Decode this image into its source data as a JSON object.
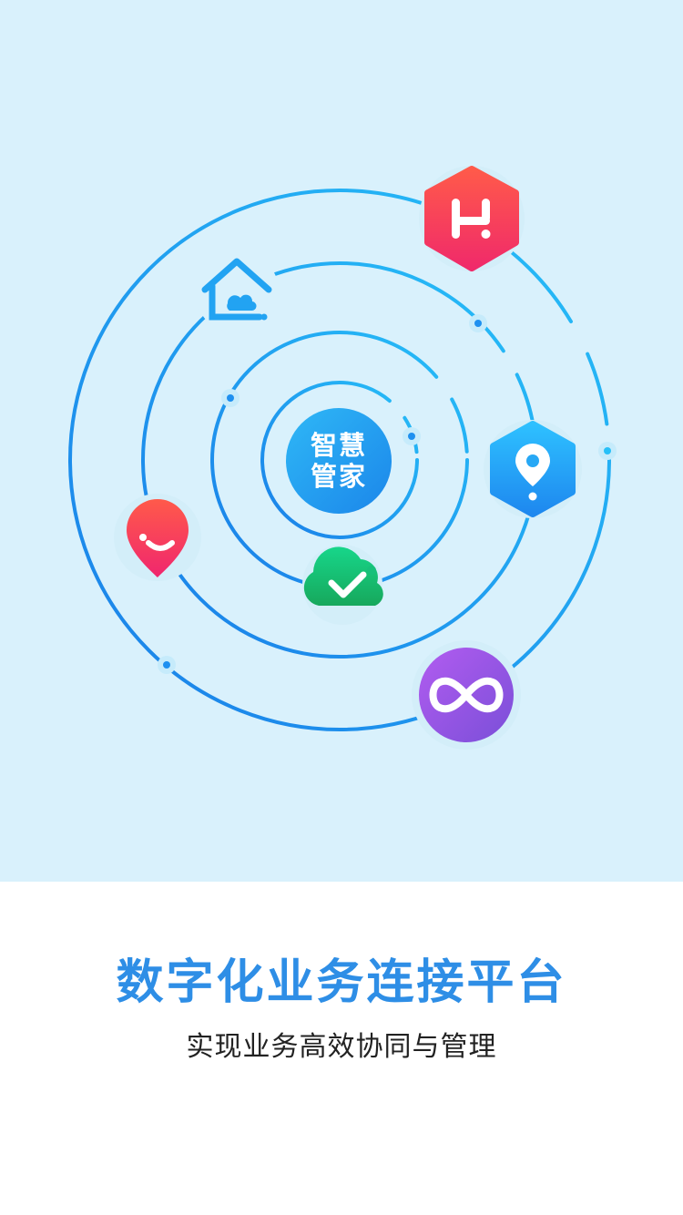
{
  "hub": {
    "line1": "智慧",
    "line2": "管家"
  },
  "onboarding": {
    "headline": "数字化业务连接平台",
    "subline": "实现业务高效协同与管理"
  },
  "icons": [
    "home-cloud-icon",
    "h-hexagon-icon",
    "location-pin-icon",
    "smile-pin-icon",
    "cloud-check-icon",
    "infinity-icon"
  ],
  "colors": {
    "background": "#d9f1fc",
    "orbit": "#1e90f0",
    "headline": "#2e8ee6",
    "subline": "#222222"
  }
}
